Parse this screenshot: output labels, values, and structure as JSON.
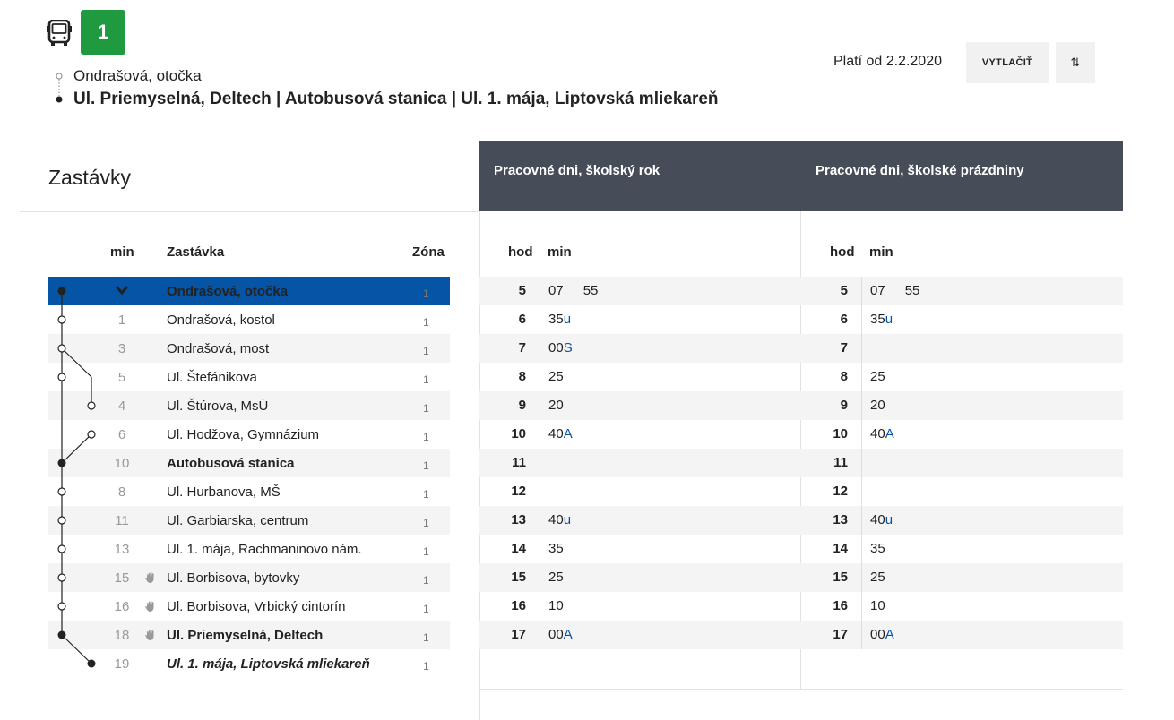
{
  "header": {
    "line_number": "1",
    "route_from": "Ondrašová, otočka",
    "route_to": "Ul. Priemyselná, Deltech | Autobusová stanica | Ul. 1. mája, Liptovská mliekareň",
    "valid_from": "Platí od 2.2.2020",
    "print_label": "VYTLAČIŤ",
    "swap_icon": "⇅",
    "line_color": "#1f9a3e"
  },
  "stops_panel": {
    "title": "Zastávky",
    "col_min": "min",
    "col_stop": "Zastávka",
    "col_zone": "Zóna",
    "stops": [
      {
        "min": "",
        "name": "Ondrašová, otočka",
        "zone": "1",
        "style": "active",
        "hand": false
      },
      {
        "min": "1",
        "name": "Ondrašová, kostol",
        "zone": "1",
        "style": "",
        "hand": false
      },
      {
        "min": "3",
        "name": "Ondrašová, most",
        "zone": "1",
        "style": "",
        "hand": false
      },
      {
        "min": "5",
        "name": "Ul. Štefánikova",
        "zone": "1",
        "style": "",
        "hand": false
      },
      {
        "min": "4",
        "name": "Ul. Štúrova, MsÚ",
        "zone": "1",
        "style": "",
        "hand": false
      },
      {
        "min": "6",
        "name": "Ul. Hodžova, Gymnázium",
        "zone": "1",
        "style": "",
        "hand": false
      },
      {
        "min": "10",
        "name": "Autobusová stanica",
        "zone": "1",
        "style": "bold",
        "hand": false
      },
      {
        "min": "8",
        "name": "Ul. Hurbanova, MŠ",
        "zone": "1",
        "style": "",
        "hand": false
      },
      {
        "min": "11",
        "name": "Ul. Garbiarska, centrum",
        "zone": "1",
        "style": "",
        "hand": false
      },
      {
        "min": "13",
        "name": "Ul. 1. mája, Rachmaninovo nám.",
        "zone": "1",
        "style": "",
        "hand": false
      },
      {
        "min": "15",
        "name": "Ul. Borbisova, bytovky",
        "zone": "1",
        "style": "",
        "hand": true
      },
      {
        "min": "16",
        "name": "Ul. Borbisova, Vrbický cintorín",
        "zone": "1",
        "style": "",
        "hand": true
      },
      {
        "min": "18",
        "name": "Ul. Priemyselná, Deltech",
        "zone": "1",
        "style": "bold",
        "hand": true
      },
      {
        "min": "19",
        "name": "Ul. 1. mája, Liptovská mliekareň",
        "zone": "1",
        "style": "italic",
        "hand": false
      }
    ]
  },
  "timetable": {
    "col_hour": "hod",
    "col_min": "min",
    "columns": [
      {
        "title": "Pracovné dni, školský rok",
        "rows": [
          {
            "hour": "5",
            "mins": [
              {
                "t": "07",
                "n": ""
              },
              {
                "t": "55",
                "n": ""
              }
            ]
          },
          {
            "hour": "6",
            "mins": [
              {
                "t": "35",
                "n": "u"
              }
            ]
          },
          {
            "hour": "7",
            "mins": [
              {
                "t": "00",
                "n": "S"
              }
            ]
          },
          {
            "hour": "8",
            "mins": [
              {
                "t": "25",
                "n": ""
              }
            ]
          },
          {
            "hour": "9",
            "mins": [
              {
                "t": "20",
                "n": ""
              }
            ]
          },
          {
            "hour": "10",
            "mins": [
              {
                "t": "40",
                "n": "A"
              }
            ]
          },
          {
            "hour": "11",
            "mins": []
          },
          {
            "hour": "12",
            "mins": []
          },
          {
            "hour": "13",
            "mins": [
              {
                "t": "40",
                "n": "u"
              }
            ]
          },
          {
            "hour": "14",
            "mins": [
              {
                "t": "35",
                "n": ""
              }
            ]
          },
          {
            "hour": "15",
            "mins": [
              {
                "t": "25",
                "n": ""
              }
            ]
          },
          {
            "hour": "16",
            "mins": [
              {
                "t": "10",
                "n": ""
              }
            ]
          },
          {
            "hour": "17",
            "mins": [
              {
                "t": "00",
                "n": "A"
              }
            ]
          }
        ]
      },
      {
        "title": "Pracovné dni, školské prázdniny",
        "rows": [
          {
            "hour": "5",
            "mins": [
              {
                "t": "07",
                "n": ""
              },
              {
                "t": "55",
                "n": ""
              }
            ]
          },
          {
            "hour": "6",
            "mins": [
              {
                "t": "35",
                "n": "u"
              }
            ]
          },
          {
            "hour": "7",
            "mins": []
          },
          {
            "hour": "8",
            "mins": [
              {
                "t": "25",
                "n": ""
              }
            ]
          },
          {
            "hour": "9",
            "mins": [
              {
                "t": "20",
                "n": ""
              }
            ]
          },
          {
            "hour": "10",
            "mins": [
              {
                "t": "40",
                "n": "A"
              }
            ]
          },
          {
            "hour": "11",
            "mins": []
          },
          {
            "hour": "12",
            "mins": []
          },
          {
            "hour": "13",
            "mins": [
              {
                "t": "40",
                "n": "u"
              }
            ]
          },
          {
            "hour": "14",
            "mins": [
              {
                "t": "35",
                "n": ""
              }
            ]
          },
          {
            "hour": "15",
            "mins": [
              {
                "t": "25",
                "n": ""
              }
            ]
          },
          {
            "hour": "16",
            "mins": [
              {
                "t": "10",
                "n": ""
              }
            ]
          },
          {
            "hour": "17",
            "mins": [
              {
                "t": "00",
                "n": "A"
              }
            ]
          }
        ]
      }
    ]
  }
}
